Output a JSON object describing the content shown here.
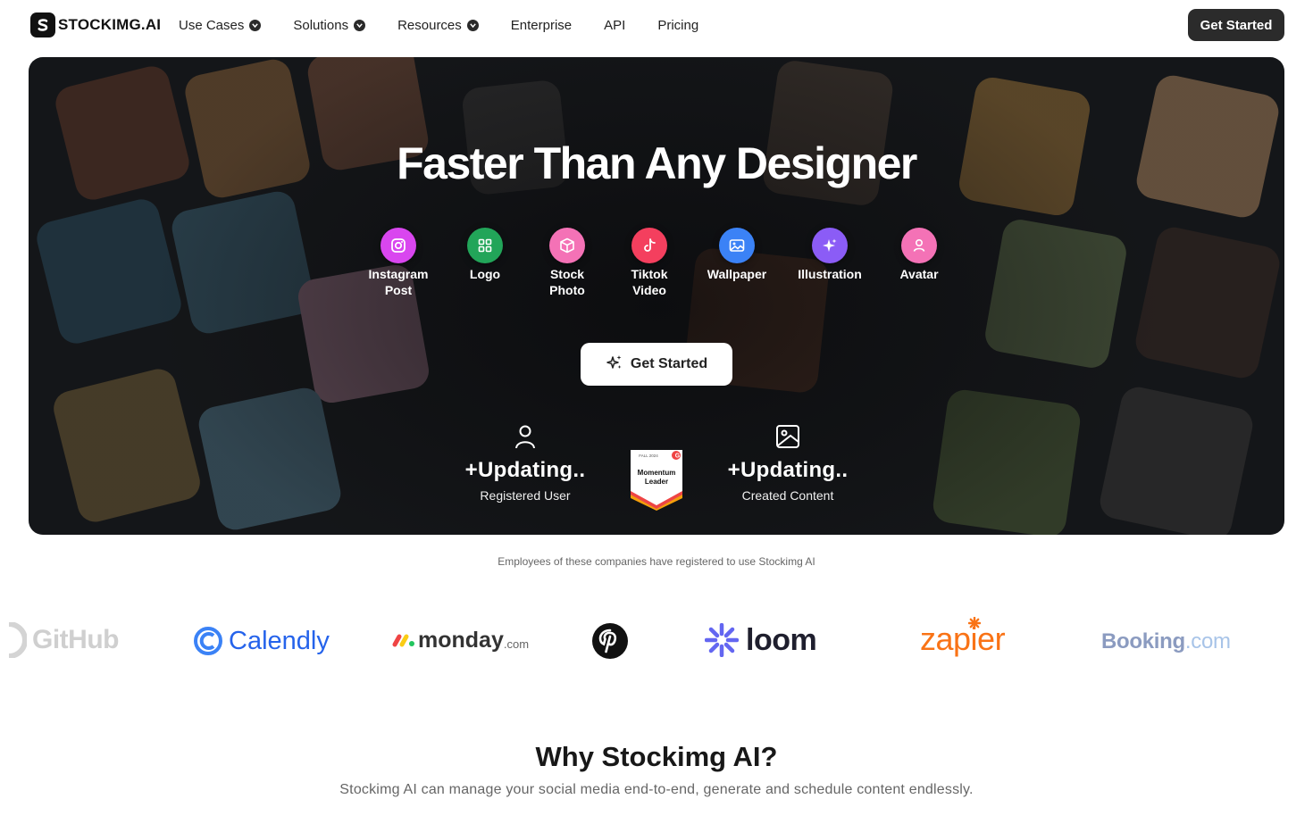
{
  "nav": {
    "logo_text": "STOCKIMG.AI",
    "menu": [
      {
        "label": "Use Cases",
        "has_dropdown": true
      },
      {
        "label": "Solutions",
        "has_dropdown": true
      },
      {
        "label": "Resources",
        "has_dropdown": true
      },
      {
        "label": "Enterprise",
        "has_dropdown": false
      },
      {
        "label": "API",
        "has_dropdown": false
      },
      {
        "label": "Pricing",
        "has_dropdown": false
      }
    ],
    "cta_label": "Get Started"
  },
  "hero": {
    "title": "Faster Than Any Designer",
    "categories": [
      {
        "line1": "Instagram",
        "line2": "Post",
        "icon": "instagram-icon",
        "color": "#d946ef"
      },
      {
        "line1": "Logo",
        "line2": "",
        "icon": "grid-icon",
        "color": "#22a559"
      },
      {
        "line1": "Stock",
        "line2": "Photo",
        "icon": "box-icon",
        "color": "#f472b6"
      },
      {
        "line1": "Tiktok",
        "line2": "Video",
        "icon": "tiktok-icon",
        "color": "#f43f5e"
      },
      {
        "line1": "Wallpaper",
        "line2": "",
        "icon": "image-icon",
        "color": "#3b82f6"
      },
      {
        "line1": "Illustration",
        "line2": "",
        "icon": "sparkle-icon",
        "color": "#8b5cf6"
      },
      {
        "line1": "Avatar",
        "line2": "",
        "icon": "user-icon",
        "color": "#f472b6"
      }
    ],
    "cta_label": "Get Started",
    "stats": [
      {
        "value": "+Updating..",
        "label": "Registered User",
        "icon": "user-outline-icon"
      },
      {
        "value": "+Updating..",
        "label": "Created Content",
        "icon": "image-outline-icon"
      }
    ],
    "badge": {
      "season": "FALL 2024",
      "line1": "Momentum",
      "line2": "Leader",
      "brand_letter": "G"
    }
  },
  "companies": {
    "caption": "Employees of these companies have registered to use Stockimg AI",
    "logos": [
      "GitHub",
      "Calendly",
      "monday",
      ".com",
      "Pinterest",
      "loom",
      "zapier",
      "Booking",
      ".com"
    ]
  },
  "why": {
    "title": "Why Stockimg AI?",
    "subtitle": "Stockimg AI can manage your social media end-to-end, generate and schedule content endlessly."
  }
}
